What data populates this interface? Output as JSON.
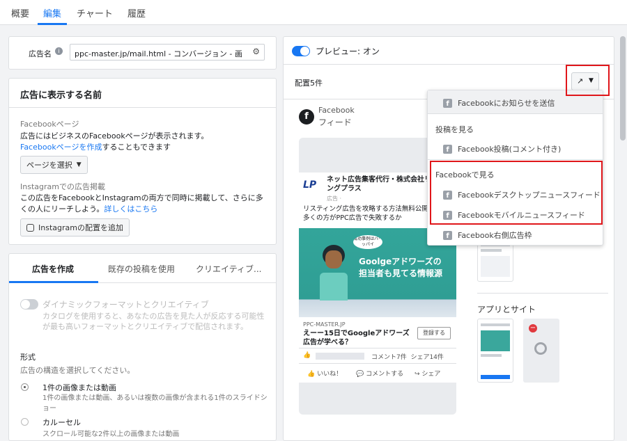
{
  "tabs": [
    {
      "label": "概要"
    },
    {
      "label": "編集"
    },
    {
      "label": "チャート"
    },
    {
      "label": "履歴"
    }
  ],
  "ad_name": {
    "label": "広告名",
    "value": "ppc-master.jp/mail.html - コンバージョン - 画像"
  },
  "identity": {
    "heading": "広告に表示する名前",
    "fb_page_label": "Facebookページ",
    "fb_page_desc": "広告にはビジネスのFacebookページが表示されます。",
    "fb_page_link": "Facebookページを作成",
    "fb_page_link_suffix": "することもできます",
    "select_page_button": "ページを選択",
    "instagram_label": "Instagramでの広告掲載",
    "instagram_desc": "この広告をFacebookとInstagramの両方で同時に掲載して、さらに多くの人にリーチしよう。",
    "instagram_link": "詳しくはこちら",
    "instagram_button": "Instagramの配置を追加"
  },
  "create": {
    "tabs": [
      "広告を作成",
      "既存の投稿を使用",
      "クリエイティブ..."
    ],
    "dynamic_label": "ダイナミックフォーマットとクリエイティブ",
    "dynamic_desc": "カタログを使用すると、あなたの広告を見た人が反応する可能性が最も高いフォーマットとクリエイティブで配信されます。",
    "format_label": "形式",
    "format_desc": "広告の構造を選択してください。",
    "options": [
      {
        "title": "1件の画像または動画",
        "desc": "1件の画像または動画、あるいは複数の画像が含まれる1件のスライドショー"
      },
      {
        "title": "カルーセル",
        "desc": "スクロール可能な2件以上の画像または動画"
      }
    ]
  },
  "preview": {
    "toggle_label": "プレビュー: オン",
    "placements_label": "配置5件",
    "feed_title": "Facebook",
    "feed_subtitle": "フィード",
    "post": {
      "page_name": "ネット広告集客代行・株式会社リスティングプラス",
      "sponsored": "広告 · ",
      "text": "リスティング広告を攻略する方法無料公開 なぜ、多くの方がPPC広告で失敗するか",
      "bubble": "成功事例はバーッパイ",
      "headline": "Goolgeアドワーズの担当者も見てる情報源",
      "link_domain": "PPC-MASTER.JP",
      "link_title": "えーー15日でGoogleアドワーズ広告が学べる？",
      "cta": "登録する",
      "stats": "コメント7件  シェア14件",
      "actions": [
        "いいね！",
        "コメントする",
        "シェア"
      ]
    },
    "apps_label": "アプリとサイト",
    "logo_text": "LP"
  },
  "dropdown": {
    "top_item": "Facebookにお知らせを送信",
    "section1": "投稿を見る",
    "item_post": "Facebook投稿(コメント付き)",
    "section2": "Facebookで見る",
    "item_desktop": "Facebookデスクトップニュースフィード",
    "item_mobile": "Facebookモバイルニュースフィード",
    "item_right": "Facebook右側広告枠"
  },
  "colors": {
    "accent": "#1877f2",
    "highlight": "#e0161a"
  }
}
